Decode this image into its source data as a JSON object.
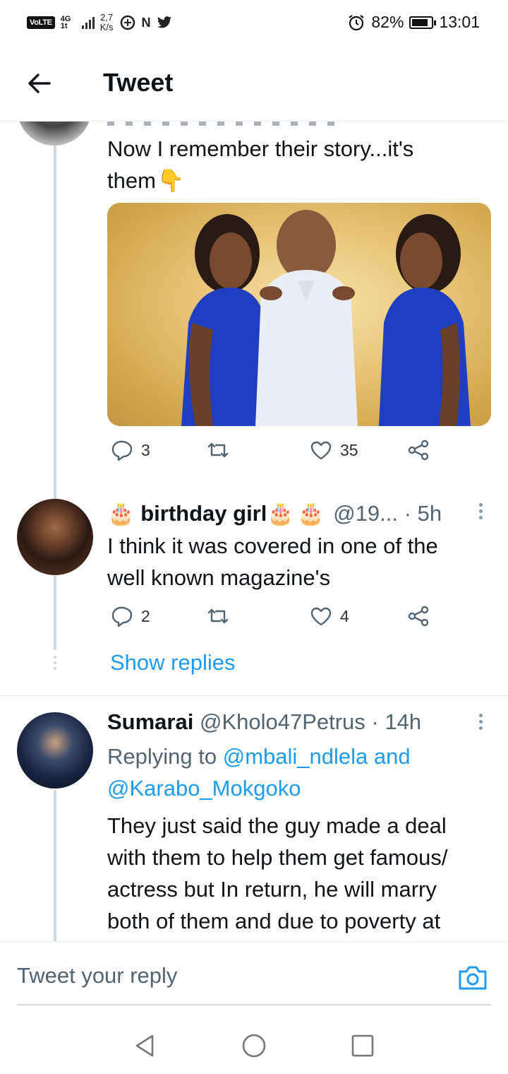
{
  "status_bar": {
    "volte": "VoLTE",
    "network": "4G",
    "network_sub": "1t",
    "speed_value": "2,7",
    "speed_unit": "K/s",
    "icons": [
      "data-saver-icon",
      "nfc-icon",
      "twitter-icon"
    ],
    "battery_percent": "82%",
    "battery_level": 0.82,
    "time": "13:01"
  },
  "header": {
    "title": "Tweet"
  },
  "tweets": [
    {
      "text_line1": "Now I remember their story...it's",
      "text_line2": "them",
      "emoji": "👇",
      "media_alt_icon": "photo",
      "replies": "3",
      "likes": "35"
    },
    {
      "name": "birthday girl",
      "handle": "@19...",
      "time": "· 5h",
      "text_line1": "I think it was covered in one of the",
      "text_line2": "well known magazine's",
      "replies": "2",
      "likes": "4",
      "show_replies": "Show replies"
    },
    {
      "name": "Sumarai",
      "handle": "@Kholo47Petrus",
      "time": "· 14h",
      "replying_to_label": "Replying to",
      "replying_to_1": "@mbali_ndlela",
      "replying_and": "and",
      "replying_to_2": "@Karabo_Mokgoko",
      "text_line1": "They just said the guy made a deal",
      "text_line2": "with them to help them get famous/",
      "text_line3": "actress but In return, he will marry",
      "text_line4": "both of them and due to poverty at"
    }
  ],
  "reply_bar": {
    "placeholder": "Tweet your reply"
  },
  "colors": {
    "accent": "#1d9bf0",
    "text": "#0f1419",
    "muted": "#536471",
    "thread_line": "#cfd9de"
  }
}
